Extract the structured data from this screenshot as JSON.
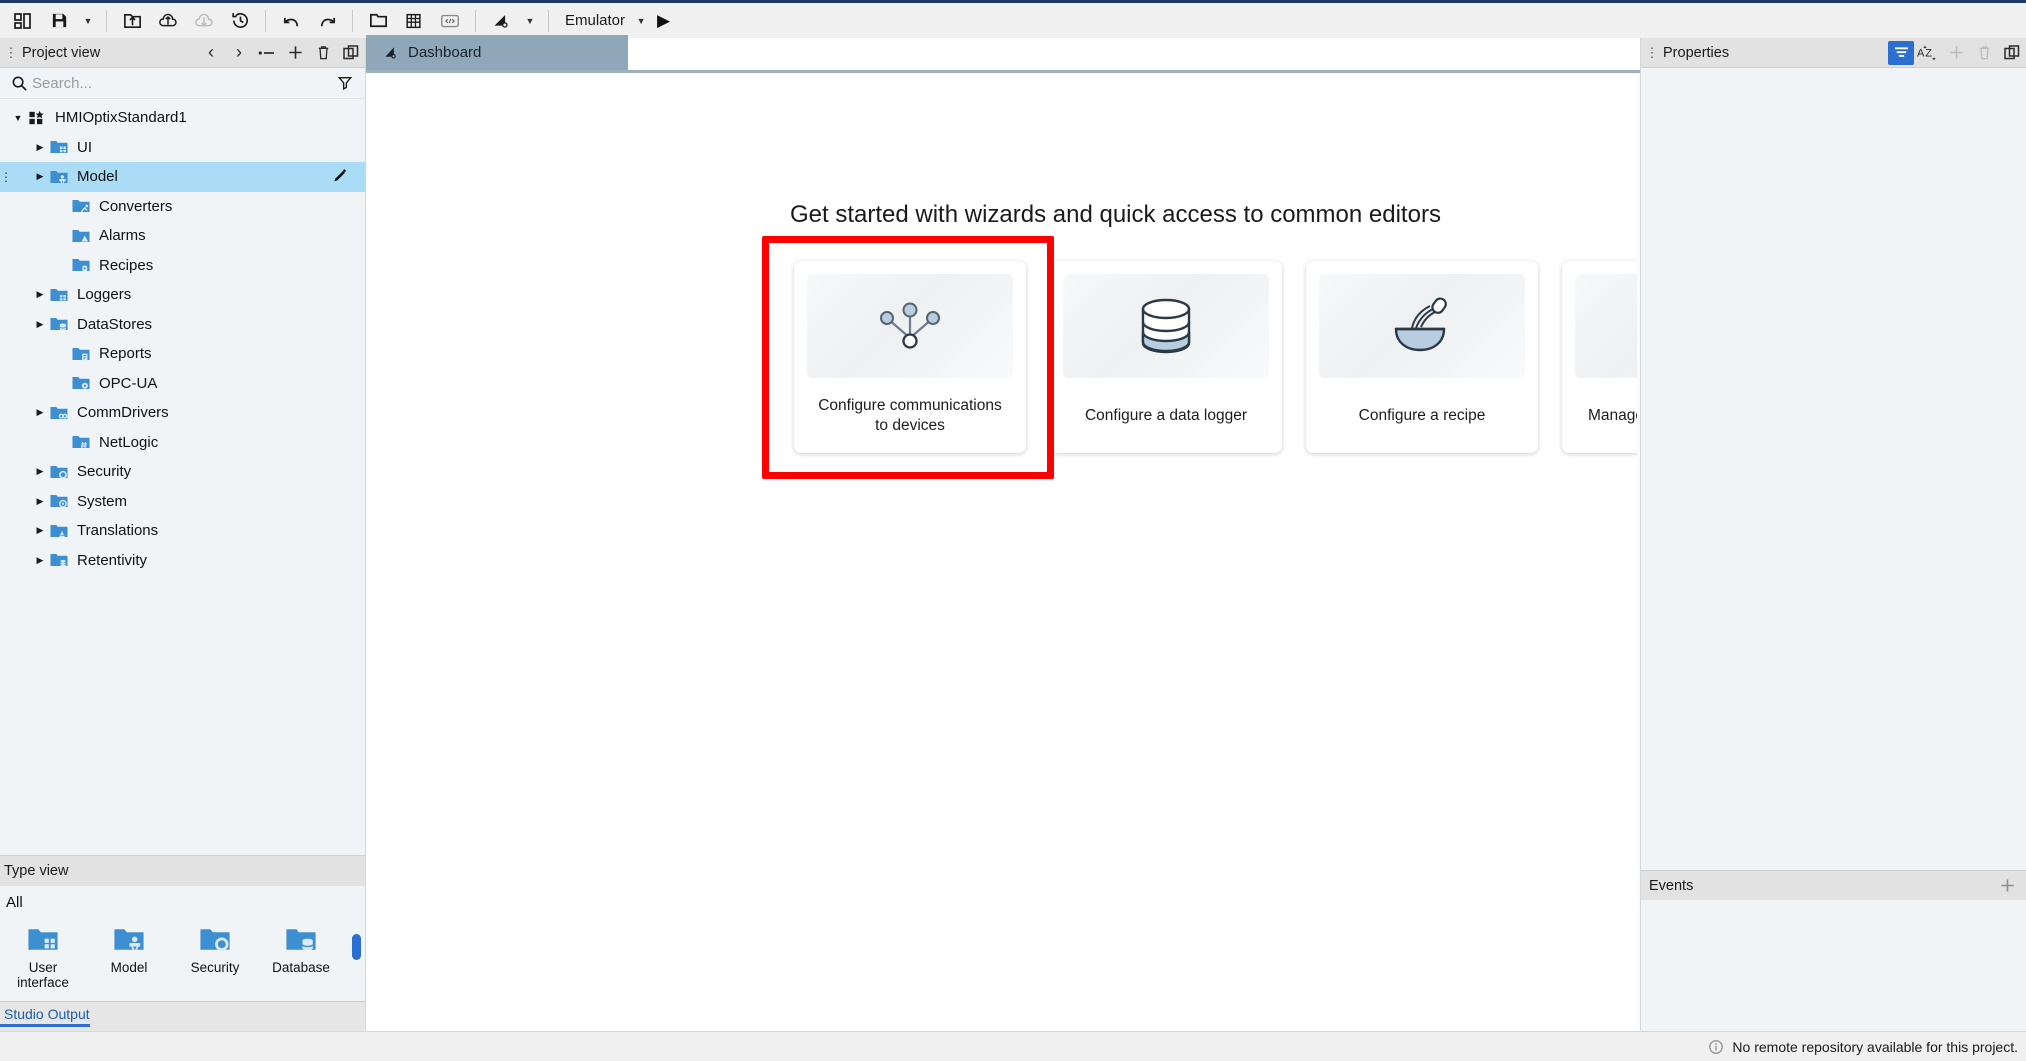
{
  "toolbar": {
    "items": [
      {
        "name": "layout-toggle-icon",
        "glyph": "layout",
        "label": "Toggle layout"
      },
      {
        "name": "save-icon",
        "glyph": "save",
        "label": "Save"
      },
      {
        "name": "save-dropdown-caret-icon",
        "glyph": "caret",
        "label": "Save options"
      },
      {
        "name": "export-project-icon",
        "glyph": "export",
        "label": "Export project"
      },
      {
        "name": "upload-cloud-icon",
        "glyph": "cloud-up",
        "label": "Upload to cloud"
      },
      {
        "name": "download-cloud-icon",
        "glyph": "cloud-down",
        "label": "Download from cloud"
      },
      {
        "name": "history-icon",
        "glyph": "history",
        "label": "History"
      },
      {
        "name": "undo-icon",
        "glyph": "undo",
        "label": "Undo"
      },
      {
        "name": "redo-icon",
        "glyph": "redo",
        "label": "Redo"
      },
      {
        "name": "open-folder-icon",
        "glyph": "folder",
        "label": "Open folder"
      },
      {
        "name": "grid-table-icon",
        "glyph": "table",
        "label": "Table view"
      },
      {
        "name": "code-icon",
        "glyph": "code",
        "label": "Code"
      },
      {
        "name": "build-icon",
        "glyph": "build",
        "label": "Build"
      },
      {
        "name": "build-dropdown-caret-icon",
        "glyph": "caret",
        "label": "Build options"
      }
    ],
    "target_label": "Emulator",
    "target_caret": "⌄",
    "run_glyph": "▶"
  },
  "project_panel": {
    "title": "Project view",
    "header_icons": [
      {
        "name": "nav-back-icon",
        "glyph": "‹"
      },
      {
        "name": "nav-forward-icon",
        "glyph": "›"
      },
      {
        "name": "collapse-all-icon",
        "glyph": "collapse"
      },
      {
        "name": "add-icon",
        "glyph": "＋"
      },
      {
        "name": "delete-icon",
        "glyph": "trash"
      },
      {
        "name": "detach-panel-icon",
        "glyph": "detach"
      }
    ],
    "search": {
      "value": "",
      "placeholder": "Search..."
    },
    "filter_icon": "filter-icon",
    "tree": [
      {
        "label": "HMIOptixStandard1",
        "depth": 0,
        "arrow": "down",
        "icon": "project-icon",
        "selected": false
      },
      {
        "label": "UI",
        "depth": 1,
        "arrow": "right",
        "icon": "folder-ui",
        "selected": false
      },
      {
        "label": "Model",
        "depth": 1,
        "arrow": "right",
        "icon": "folder-model",
        "selected": true
      },
      {
        "label": "Converters",
        "depth": 2,
        "arrow": "none",
        "icon": "folder-converters",
        "selected": false
      },
      {
        "label": "Alarms",
        "depth": 2,
        "arrow": "none",
        "icon": "folder-alarms",
        "selected": false
      },
      {
        "label": "Recipes",
        "depth": 2,
        "arrow": "none",
        "icon": "folder-recipes",
        "selected": false
      },
      {
        "label": "Loggers",
        "depth": 1,
        "arrow": "right",
        "icon": "folder-loggers",
        "selected": false
      },
      {
        "label": "DataStores",
        "depth": 1,
        "arrow": "right",
        "icon": "folder-datastores",
        "selected": false
      },
      {
        "label": "Reports",
        "depth": 2,
        "arrow": "none",
        "icon": "folder-reports",
        "selected": false
      },
      {
        "label": "OPC-UA",
        "depth": 2,
        "arrow": "none",
        "icon": "folder-opcua",
        "selected": false
      },
      {
        "label": "CommDrivers",
        "depth": 1,
        "arrow": "right",
        "icon": "folder-comm",
        "selected": false
      },
      {
        "label": "NetLogic",
        "depth": 2,
        "arrow": "none",
        "icon": "folder-netlogic",
        "selected": false
      },
      {
        "label": "Security",
        "depth": 1,
        "arrow": "right",
        "icon": "folder-security",
        "selected": false
      },
      {
        "label": "System",
        "depth": 1,
        "arrow": "right",
        "icon": "folder-system",
        "selected": false
      },
      {
        "label": "Translations",
        "depth": 1,
        "arrow": "right",
        "icon": "folder-translations",
        "selected": false
      },
      {
        "label": "Retentivity",
        "depth": 1,
        "arrow": "right",
        "icon": "folder-retentivity",
        "selected": false
      }
    ]
  },
  "type_view": {
    "title": "Type view",
    "all_label": "All",
    "items": [
      {
        "label": "User\ninterface",
        "icon": "folder-ui"
      },
      {
        "label": "Model",
        "icon": "folder-model"
      },
      {
        "label": "Security",
        "icon": "folder-security"
      },
      {
        "label": "Database",
        "icon": "folder-datastores"
      }
    ]
  },
  "studio_output": {
    "label": "Studio Output"
  },
  "editor": {
    "tabs": [
      {
        "label": "Dashboard",
        "icon": "dashboard-icon",
        "active": true
      }
    ],
    "heading": "Get started with wizards and quick access to common editors",
    "cards": [
      {
        "label": "Configure communications\nto devices",
        "icon": "network-nodes-icon",
        "highlighted": true
      },
      {
        "label": "Configure a data logger",
        "icon": "database-icon",
        "highlighted": false
      },
      {
        "label": "Configure a recipe",
        "icon": "whisk-bowl-icon",
        "highlighted": false
      },
      {
        "label": "Manage users and groups",
        "icon": "users-group-icon",
        "highlighted": false
      }
    ],
    "highlight_color": "#fe0000"
  },
  "properties_panel": {
    "title": "Properties",
    "header_icons": [
      {
        "name": "filter-properties-icon",
        "glyph": "filter-lines",
        "active": true
      },
      {
        "name": "sort-alpha-icon",
        "glyph": "az",
        "active": false
      },
      {
        "name": "add-icon",
        "glyph": "＋",
        "active": false,
        "dim": true
      },
      {
        "name": "delete-icon",
        "glyph": "trash",
        "active": false,
        "dim": true
      },
      {
        "name": "detach-panel-icon",
        "glyph": "detach",
        "active": false
      }
    ]
  },
  "events_panel": {
    "title": "Events",
    "add_glyph": "＋"
  },
  "statusbar": {
    "info_icon": "info-icon",
    "message": "No remote repository available for this project."
  },
  "colors": {
    "accent_blue": "#2c6fd1",
    "selection_blue": "#aadcf5",
    "tab_active": "#8fa7b8",
    "title_bar": "#1f3864",
    "highlight_red": "#fe0000"
  }
}
